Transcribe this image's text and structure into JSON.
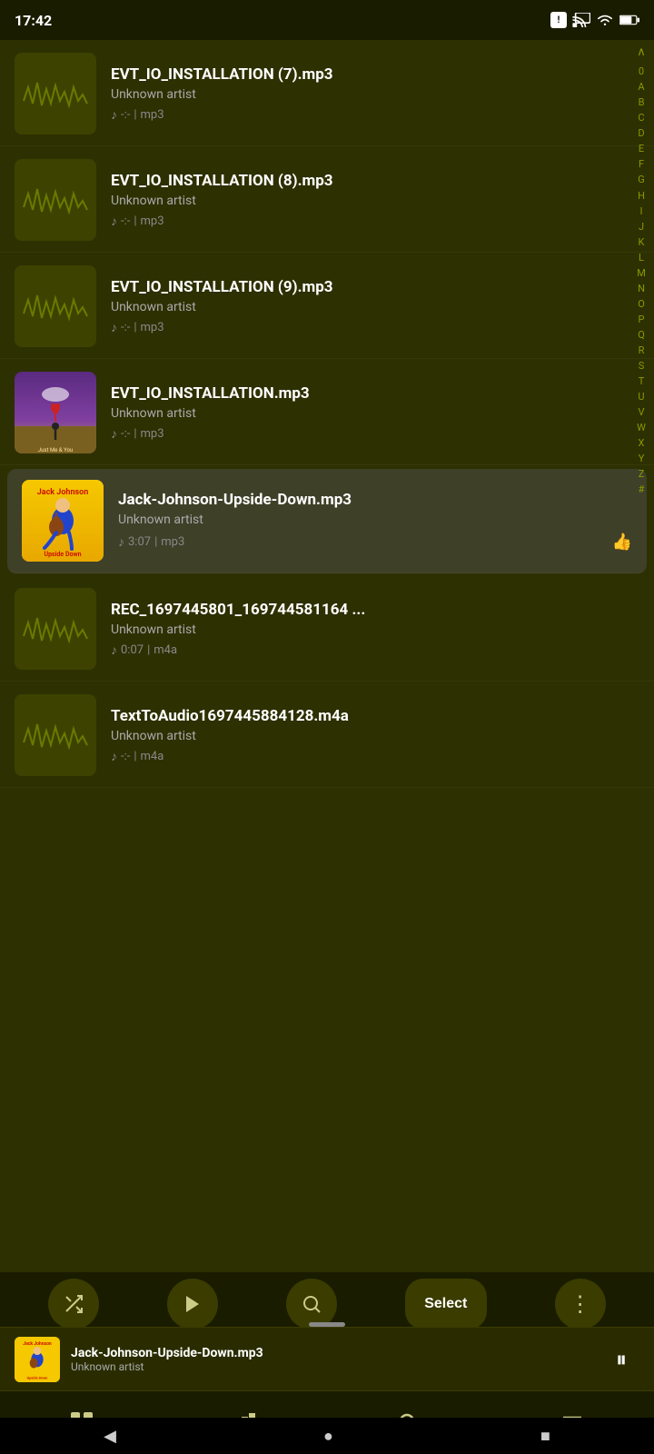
{
  "statusBar": {
    "time": "17:42",
    "notificationBadge": "!",
    "icons": [
      "cast",
      "wifi",
      "battery"
    ]
  },
  "alphabetSidebar": {
    "upArrow": "⌃",
    "letters": [
      "0",
      "A",
      "B",
      "C",
      "D",
      "E",
      "F",
      "G",
      "H",
      "I",
      "J",
      "K",
      "L",
      "M",
      "N",
      "O",
      "P",
      "Q",
      "R",
      "S",
      "T",
      "U",
      "V",
      "W",
      "X",
      "Y",
      "Z",
      "#"
    ]
  },
  "songs": [
    {
      "id": "evt7",
      "title": "EVT_IO_INSTALLATION (7).mp3",
      "artist": "Unknown artist",
      "duration": "-:-",
      "format": "mp3",
      "hasArt": false,
      "isActive": false
    },
    {
      "id": "evt8",
      "title": "EVT_IO_INSTALLATION (8).mp3",
      "artist": "Unknown artist",
      "duration": "-:-",
      "format": "mp3",
      "hasArt": false,
      "isActive": false
    },
    {
      "id": "evt9",
      "title": "EVT_IO_INSTALLATION (9).mp3",
      "artist": "Unknown artist",
      "duration": "-:-",
      "format": "mp3",
      "hasArt": false,
      "isActive": false
    },
    {
      "id": "evtbase",
      "title": "EVT_IO_INSTALLATION.mp3",
      "artist": "Unknown artist",
      "duration": "-:-",
      "format": "mp3",
      "hasArt": true,
      "artType": "just-me-you",
      "isActive": false
    },
    {
      "id": "jj",
      "title": "Jack-Johnson-Upside-Down.mp3",
      "artist": "Unknown artist",
      "duration": "3:07",
      "format": "mp3",
      "hasArt": true,
      "artType": "jack-johnson",
      "isActive": true,
      "showThumbsUp": true
    },
    {
      "id": "rec",
      "title": "REC_1697445801_169744581164 ...",
      "artist": "Unknown artist",
      "duration": "0:07",
      "format": "m4a",
      "hasArt": false,
      "isActive": false
    },
    {
      "id": "tta",
      "title": "TextToAudio1697445884128.m4a",
      "artist": "Unknown artist",
      "duration": "-:-",
      "format": "m4a",
      "hasArt": false,
      "isActive": false
    }
  ],
  "toolbar": {
    "shuffleLabel": "⇄",
    "playLabel": "▶",
    "searchLabel": "🔍",
    "selectLabel": "Select",
    "moreLabel": "⋮"
  },
  "miniPlayer": {
    "title": "Jack-Johnson-Upside-Down.mp3",
    "artist": "Unknown artist",
    "pauseIcon": "⏸"
  },
  "bottomNav": {
    "gridIcon": "⊞",
    "chartsIcon": "📊",
    "searchIcon": "🔍",
    "menuIcon": "☰"
  },
  "systemNav": {
    "backIcon": "◀",
    "homeIcon": "●",
    "recentIcon": "■"
  }
}
